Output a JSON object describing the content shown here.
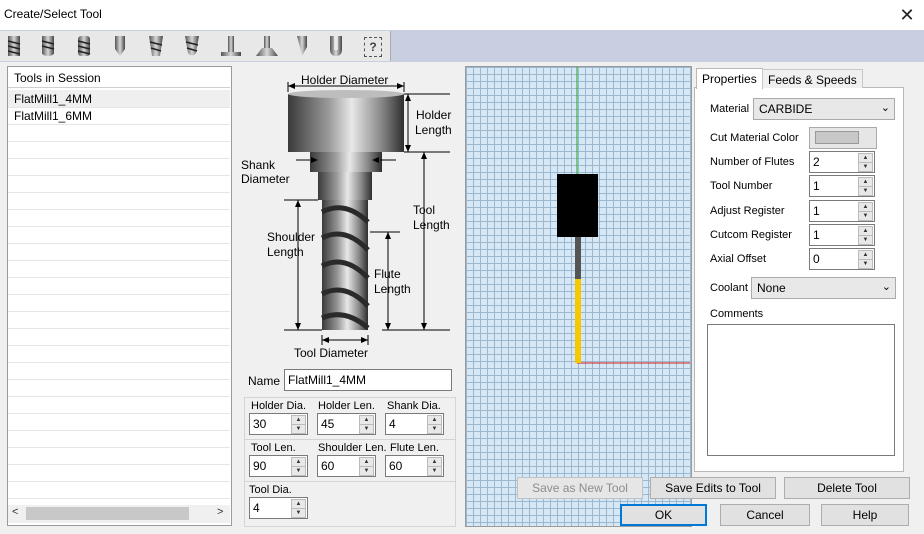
{
  "window": {
    "title": "Create/Select Tool",
    "close_glyph": "✕"
  },
  "toolbar": {
    "icons": [
      "flat-mill-icon",
      "ball-mill-icon",
      "bull-mill-icon",
      "drill-icon",
      "taper-mill-icon",
      "taper-ball-icon",
      "tslot-icon",
      "dovetail-icon",
      "engraving-icon",
      "fillet-icon",
      "help-icon"
    ],
    "help_label": "?"
  },
  "session": {
    "header": "Tools in Session",
    "items": [
      "FlatMill1_4MM",
      "FlatMill1_6MM"
    ],
    "selected_index": 0,
    "scroll_left": "<",
    "scroll_right": ">"
  },
  "diagram": {
    "holder_diameter": "Holder Diameter",
    "holder_length_1": "Holder",
    "holder_length_2": "Length",
    "shank_diameter_1": "Shank",
    "shank_diameter_2": "Diameter",
    "tool_length_1": "Tool",
    "tool_length_2": "Length",
    "shoulder_length_1": "Shoulder",
    "shoulder_length_2": "Length",
    "flute_length_1": "Flute",
    "flute_length_2": "Length",
    "tool_diameter": "Tool Diameter"
  },
  "params": {
    "name_label": "Name",
    "name_value": "FlatMill1_4MM",
    "holder_dia_label": "Holder Dia.",
    "holder_dia": "30",
    "holder_len_label": "Holder Len.",
    "holder_len": "45",
    "shank_dia_label": "Shank Dia.",
    "shank_dia": "4",
    "tool_len_label": "Tool Len.",
    "tool_len": "90",
    "shoulder_len_label": "Shoulder Len.",
    "shoulder_len": "60",
    "flute_len_label": "Flute Len.",
    "flute_len": "60",
    "tool_dia_label": "Tool Dia.",
    "tool_dia": "4"
  },
  "tabs": {
    "properties": "Properties",
    "feeds": "Feeds & Speeds"
  },
  "properties": {
    "material_label": "Material",
    "material_value": "CARBIDE",
    "cut_color_label": "Cut Material Color",
    "flutes_label": "Number of Flutes",
    "flutes_value": "2",
    "tool_number_label": "Tool Number",
    "tool_number_value": "1",
    "adjust_label": "Adjust Register",
    "adjust_value": "1",
    "cutcom_label": "Cutcom Register",
    "cutcom_value": "1",
    "axial_label": "Axial Offset",
    "axial_value": "0",
    "coolant_label": "Coolant",
    "coolant_value": "None",
    "comments_label": "Comments",
    "chevron": "⌄"
  },
  "buttons": {
    "save_new": "Save as New Tool",
    "save_edits": "Save Edits to Tool",
    "delete": "Delete Tool",
    "ok": "OK",
    "cancel": "Cancel",
    "help": "Help"
  },
  "colors": {
    "viewport_bg": "#d6e8f6",
    "flute": "#f5c800",
    "y_axis": "#1aa31a",
    "x_axis": "#d21a1a",
    "accent": "#0078d7"
  }
}
